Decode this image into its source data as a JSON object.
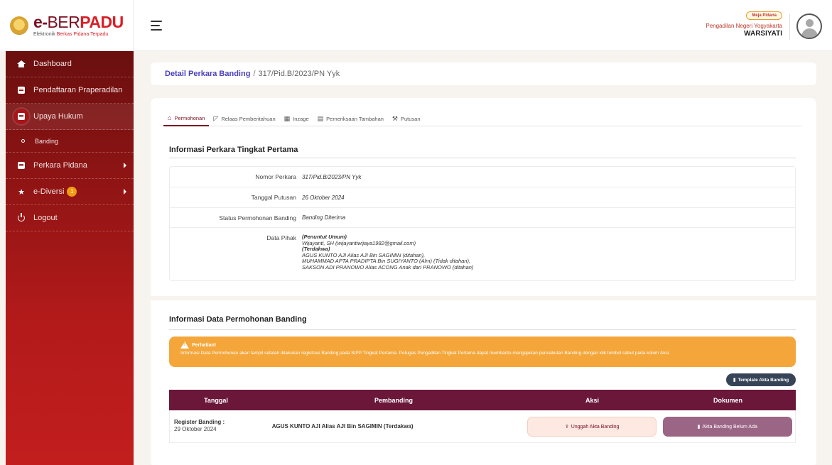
{
  "brand": {
    "title_e": "e-",
    "title_ber": "BER",
    "title_padu": "PADU",
    "subtitle_a": "Elektronik ",
    "subtitle_b": "Berkas Pidana Terpadu"
  },
  "header": {
    "role_badge": "Meja Pidana",
    "court": "Pengadilan Negeri Yogyakarta",
    "username": "WARSIYATI"
  },
  "sidebar": {
    "items": [
      {
        "label": "Dashboard",
        "icon": "home-icon"
      },
      {
        "label": "Pendaftaran Praperadilan",
        "icon": "document-icon"
      },
      {
        "label": "Upaya Hukum",
        "icon": "document-icon"
      },
      {
        "label": "Banding",
        "icon": "circle-icon"
      },
      {
        "label": "Perkara Pidana",
        "icon": "folder-icon"
      },
      {
        "label": "e-Diversi",
        "icon": "star-icon",
        "badge": "1"
      },
      {
        "label": "Logout",
        "icon": "power-icon"
      }
    ]
  },
  "breadcrumb": {
    "link": "Detail Perkara Banding",
    "separator": "/",
    "current": "317/Pid.B/2023/PN Yyk"
  },
  "tabs": [
    {
      "label": "Permohonan",
      "icon": "home-icon"
    },
    {
      "label": "Relaas Pemberitahuan",
      "icon": "megaphone-icon"
    },
    {
      "label": "Inzage",
      "icon": "calendar-icon"
    },
    {
      "label": "Pemeriksaan Tambahan",
      "icon": "chat-icon"
    },
    {
      "label": "Putusan",
      "icon": "gavel-icon"
    }
  ],
  "first_instance": {
    "title": "Informasi Perkara Tingkat Pertama",
    "rows": [
      {
        "label": "Nomor Perkara",
        "value": "317/Pid.B/2023/PN Yyk"
      },
      {
        "label": "Tanggal Putusan",
        "value": "26 Oktober 2024"
      },
      {
        "label": "Status Permohonan Banding",
        "value": "Banding Diterima"
      },
      {
        "label": "Data Pihak"
      }
    ],
    "pihak": [
      "(Penuntut Umum)",
      "Wijayanti, SH (wijayantiwijaya1982@gmail.com)",
      "(Terdakwa)",
      "AGUS KUNTO AJI Alias AJI Bin SAGIMIN (ditahan),",
      "MUHAMMAD APTA PRADIPTA Bin SUGIYANTO (Alm) (Tidak ditahan),",
      "SAKSON ADI PRANOWO Alias ACONG Anak dari PRANOWO (ditahan)"
    ]
  },
  "appeal": {
    "title": "Informasi Data Permohonan Banding",
    "alert_title": "Perhatian!",
    "alert_message": "Informasi Data Permohonan akan tampil setelah dilakukan registrasi Banding pada SIPP Tingkat Pertama. Petugas Pengadilan Tingkat Pertama dapat membantu mengajukan pencabutan Banding dengan klik tombol cabut pada kolom Aksi.",
    "template_button": "Template Akta Banding",
    "columns": [
      "Tanggal",
      "Pembanding",
      "Aksi",
      "Dokumen"
    ],
    "rows": [
      {
        "register_label": "Register Banding :",
        "register_date": "29 Oktober 2024",
        "pembanding": "AGUS KUNTO AJI Alias AJI Bin SAGIMIN (Terdakwa)",
        "action_label": "Unggah Akta Banding",
        "document_label": "Akta Banding Belum Ada"
      }
    ]
  },
  "colors": {
    "sidebar_top": "#6a0f0f",
    "sidebar_bottom": "#c21e1e",
    "accent": "#7a1021",
    "table_header": "#6a1739",
    "alert": "#f4a63b",
    "doc_button": "#9b6585"
  }
}
